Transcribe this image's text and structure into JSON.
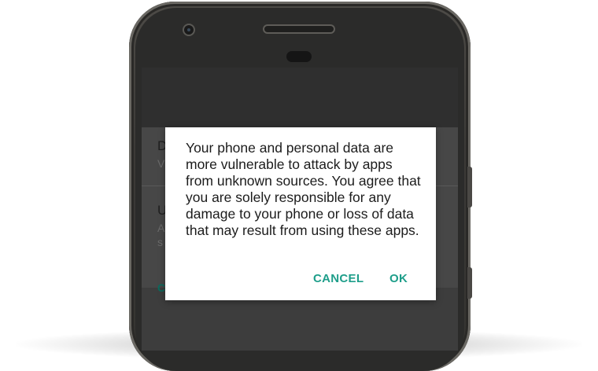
{
  "dialog": {
    "message": "Your phone and personal data are more vulnerable to attack by apps from unknown sources. You agree that you are solely responsible for any damage to your phone or loss of data that may result from using these apps.",
    "cancel_label": "CANCEL",
    "ok_label": "OK",
    "accent_color": "#1e9e8a"
  },
  "background_settings": {
    "item1_title_fragment": "D",
    "item1_subtitle_fragment": "V",
    "item2_title_fragment": "U",
    "item2_subtitle_fragment_line1": "A",
    "item2_subtitle_fragment_line2": "s",
    "action_fragment": "C"
  },
  "icons": {
    "front_camera": "camera-icon",
    "earpiece": "speaker-icon",
    "proximity_sensor": "sensor-icon"
  }
}
